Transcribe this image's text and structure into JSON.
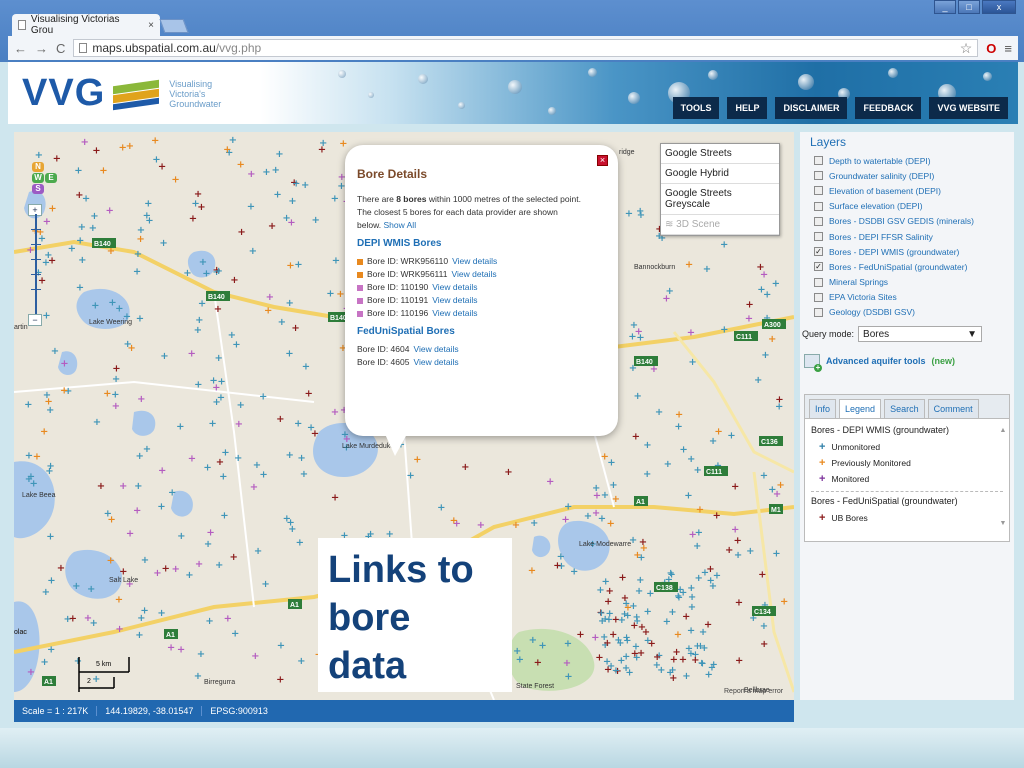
{
  "browser": {
    "tab_title": "Visualising Victorias Grou",
    "tab_close": "×",
    "url_host": "maps.ubspatial.com.au",
    "url_path": "/vvg.php",
    "window_controls": [
      "_",
      "□",
      "x"
    ]
  },
  "site": {
    "logo": "VVG",
    "logo_sub": [
      "Visualising",
      "Victoria's",
      "Groundwater"
    ],
    "nav": [
      "TOOLS",
      "HELP",
      "DISCLAIMER",
      "FEEDBACK",
      "VVG WEBSITE"
    ]
  },
  "map": {
    "nwse": [
      "N",
      "W",
      "E",
      "S"
    ],
    "zoom_in": "+",
    "zoom_out": "−",
    "basemaps": [
      "Google Streets",
      "Google Hybrid",
      "Google Streets Greyscale",
      "3D Scene"
    ],
    "place_labels": [
      "Lake Weering",
      "Lake Murdeduke",
      "Lake Modewarre",
      "Salt Lake",
      "Lake Beea",
      "Birregurra",
      "State Forest",
      "Bannockburn",
      "Bellbrae",
      "ridge",
      "artin",
      "olac",
      "olac"
    ],
    "road_labels": [
      "B140",
      "B140",
      "B140",
      "B140",
      "A300",
      "C111",
      "C136",
      "C111",
      "A1",
      "A1",
      "A1",
      "A1",
      "M1",
      "C134",
      "C138"
    ],
    "scale_label": "5 km",
    "scale_label_2": "2",
    "report": "Report a map error"
  },
  "popup": {
    "title": "Bore Details",
    "intro_pre": "There are ",
    "intro_count": "8 bores",
    "intro_post": " within 1000 metres of the selected point.",
    "intro_line2": "The closest 5 bores for each data provider are shown",
    "intro_line3": "below.",
    "show_all": "Show All",
    "close": "×",
    "depi_heading": "DEPI WMIS Bores",
    "depi_bores": [
      {
        "id": "Bore ID: WRK956110",
        "link": "View details",
        "color": "#e8891f"
      },
      {
        "id": "Bore ID: WRK956111",
        "link": "View details",
        "color": "#e8891f"
      },
      {
        "id": "Bore ID: 110190",
        "link": "View details",
        "color": "#c774c4"
      },
      {
        "id": "Bore ID: 110191",
        "link": "View details",
        "color": "#c774c4"
      },
      {
        "id": "Bore ID: 110196",
        "link": "View details",
        "color": "#c774c4"
      }
    ],
    "fed_heading": "FedUniSpatial Bores",
    "fed_bores": [
      {
        "id": "Bore ID: 4604",
        "link": "View details"
      },
      {
        "id": "Bore ID: 4605",
        "link": "View details"
      }
    ]
  },
  "callout": {
    "lines": [
      "Links to",
      "bore",
      "data"
    ]
  },
  "status": {
    "scale": "Scale = 1 : 217K",
    "coords": "144.19829, -38.01547",
    "epsg": "EPSG:900913"
  },
  "panel": {
    "title": "Layers",
    "layers": [
      {
        "label": "Depth to watertable (DEPI)",
        "checked": false
      },
      {
        "label": "Groundwater salinity (DEPI)",
        "checked": false
      },
      {
        "label": "Elevation of basement (DEPI)",
        "checked": false
      },
      {
        "label": "Surface elevation (DEPI)",
        "checked": false
      },
      {
        "label": "Bores - DSDBI GSV GEDIS (minerals)",
        "checked": false
      },
      {
        "label": "Bores - DEPI FFSR Salinity",
        "checked": false
      },
      {
        "label": "Bores - DEPI WMIS (groundwater)",
        "checked": true
      },
      {
        "label": "Bores - FedUniSpatial (groundwater)",
        "checked": true
      },
      {
        "label": "Mineral Springs",
        "checked": false
      },
      {
        "label": "EPA Victoria Sites",
        "checked": false
      },
      {
        "label": "Geology (DSDBI GSV)",
        "checked": false
      }
    ],
    "check_mark": "✓",
    "query_label": "Query mode:",
    "query_value": "Bores",
    "advanced": "Advanced aquifer tools",
    "advanced_new": "(new)",
    "tabs": [
      "Info",
      "Legend",
      "Search",
      "Comment"
    ],
    "legend_group1": "Bores - DEPI WMIS (groundwater)",
    "legend_items1": [
      {
        "label": "Unmonitored",
        "color": "#2f7fa8"
      },
      {
        "label": "Previously Monitored",
        "color": "#e8891f"
      },
      {
        "label": "Monitored",
        "color": "#7b2f9a"
      }
    ],
    "legend_group2": "Bores - FedUniSpatial (groundwater)",
    "legend_items2": [
      {
        "label": "UB Bores",
        "color": "#8a1a1a"
      }
    ]
  }
}
